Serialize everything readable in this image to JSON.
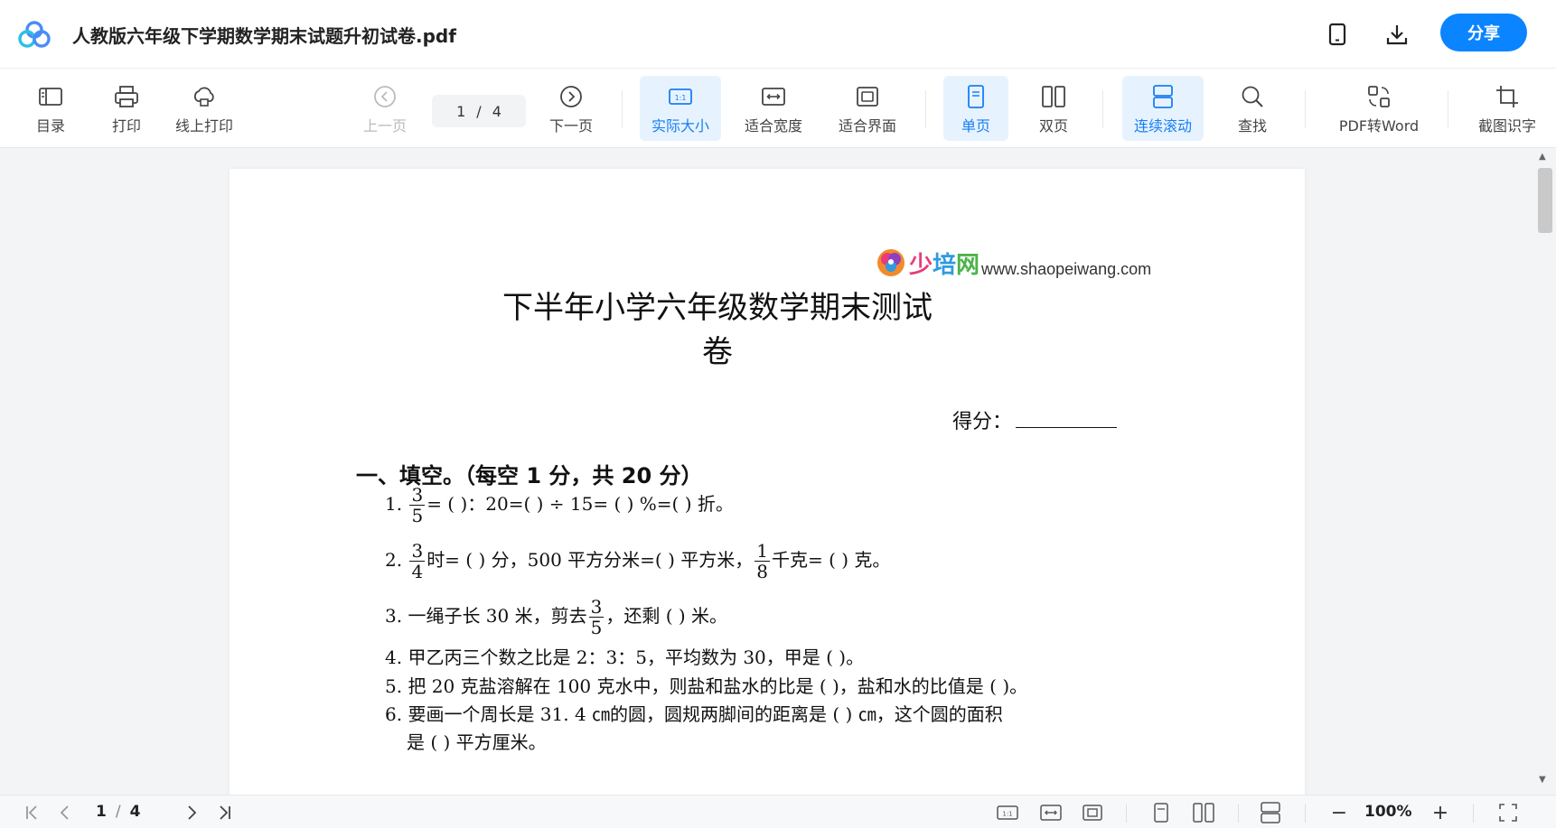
{
  "header": {
    "file_title": "人教版六年级下学期数学期末试题升初试卷.pdf",
    "share_label": "分享",
    "icons": [
      "app-logo",
      "mobile-icon",
      "download-icon"
    ]
  },
  "toolbar": {
    "toc_label": "目录",
    "print_label": "打印",
    "online_print_label": "线上打印",
    "prev_label": "上一页",
    "current_page": "1",
    "page_sep": "/",
    "total_pages": "4",
    "next_label": "下一页",
    "actual_size_label": "实际大小",
    "actual_size_badge": "1:1",
    "fit_width_label": "适合宽度",
    "fit_page_label": "适合界面",
    "single_page_label": "单页",
    "double_page_label": "双页",
    "continuous_label": "连续滚动",
    "find_label": "查找",
    "pdf_to_word_label": "PDF转Word",
    "ocr_label": "截图识字",
    "accent_color": "#1a7ef2"
  },
  "document": {
    "site_logo_cn": [
      "少",
      "培",
      "网"
    ],
    "site_url": "www.shaopeiwang.com",
    "title": "下半年小学六年级数学期末测试卷",
    "score_label": "得分：",
    "section1": "一、填空。（每空 1 分，共 20 分）",
    "q1": {
      "num": "1.",
      "frac_num": "3",
      "frac_den": "5",
      "text": "= (        )：20=(       ) ÷  15= (        ) %=(       ) 折。"
    },
    "q2": {
      "num": "2.",
      "frac_num": "3",
      "frac_den": "4",
      "text_a": "时= (        ) 分，500 平方分米=(       ) 平方米，",
      "frac2_num": "1",
      "frac2_den": "8",
      "text_b": "千克= (        ) 克。"
    },
    "q3": {
      "text_a": "3. 一绳子长 30 米，剪去",
      "frac_num": "3",
      "frac_den": "5",
      "text_b": "，还剩 (        ) 米。"
    },
    "q4": "4. 甲乙丙三个数之比是 2：3：5，平均数为 30，甲是 (        )。",
    "q5": "5. 把 20 克盐溶解在 100 克水中，则盐和盐水的比是 (        )，盐和水的比值是 (        )。",
    "q6": "6. 要画一个周长是 31. 4 ㎝的圆，圆规两脚间的距离是 (        ) ㎝，这个圆的面积",
    "q6b": "是 (        ) 平方厘米。"
  },
  "statusbar": {
    "current_page": "1",
    "page_sep": "/",
    "total_pages": "4",
    "zoom_level": "100%",
    "actual_size_badge": "1:1",
    "zoom_out": "−",
    "zoom_in": "+"
  }
}
